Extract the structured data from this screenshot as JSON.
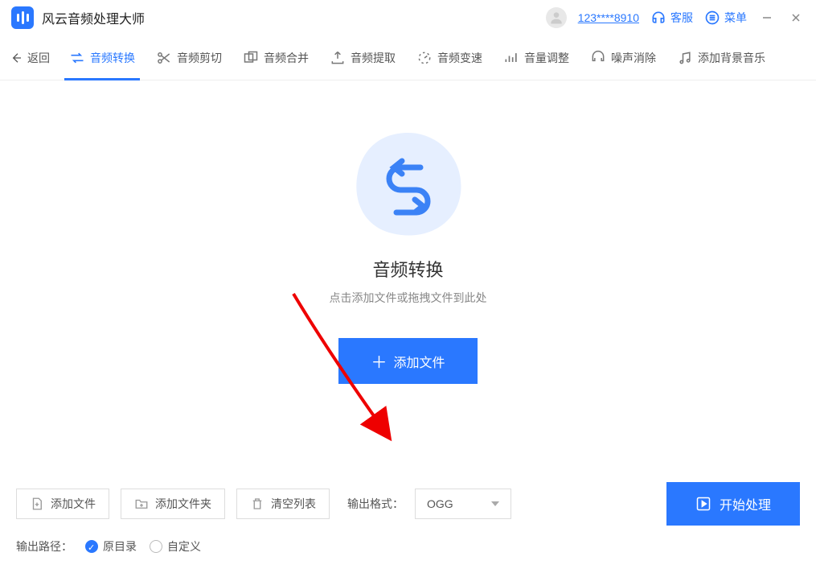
{
  "app": {
    "title": "风云音频处理大师"
  },
  "header": {
    "username": "123****8910",
    "support_label": "客服",
    "menu_label": "菜单"
  },
  "nav": {
    "back_label": "返回",
    "items": [
      {
        "label": "音频转换"
      },
      {
        "label": "音频剪切"
      },
      {
        "label": "音频合并"
      },
      {
        "label": "音频提取"
      },
      {
        "label": "音频变速"
      },
      {
        "label": "音量调整"
      },
      {
        "label": "噪声消除"
      },
      {
        "label": "添加背景音乐"
      }
    ]
  },
  "center": {
    "title": "音频转换",
    "subtitle": "点击添加文件或拖拽文件到此处",
    "add_label": "添加文件"
  },
  "bottom": {
    "add_file_label": "添加文件",
    "add_folder_label": "添加文件夹",
    "clear_label": "清空列表",
    "output_format_label": "输出格式：",
    "output_format_value": "OGG",
    "start_label": "开始处理",
    "output_path_label": "输出路径：",
    "radio_original": "原目录",
    "radio_custom": "自定义"
  }
}
